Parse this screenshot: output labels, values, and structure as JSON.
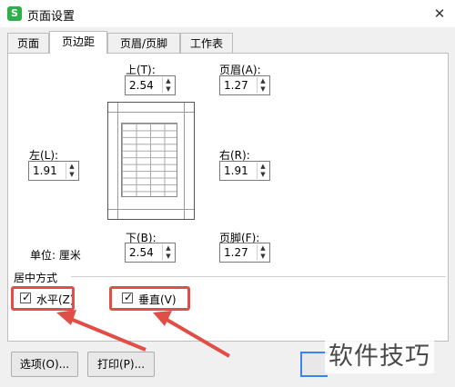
{
  "window": {
    "title": "页面设置",
    "app_icon_letter": "S",
    "close_glyph": "✕"
  },
  "tabs": [
    {
      "label": "页面",
      "active": false
    },
    {
      "label": "页边距",
      "active": true
    },
    {
      "label": "页眉/页脚",
      "active": false
    },
    {
      "label": "工作表",
      "active": false
    }
  ],
  "margins": {
    "top": {
      "label": "上(T):",
      "value": "2.54"
    },
    "header": {
      "label": "页眉(A):",
      "value": "1.27"
    },
    "left": {
      "label": "左(L):",
      "value": "1.91"
    },
    "right": {
      "label": "右(R):",
      "value": "1.91"
    },
    "bottom": {
      "label": "下(B):",
      "value": "2.54"
    },
    "footer": {
      "label": "页脚(F):",
      "value": "1.27"
    },
    "unit_label": "单位: 厘米"
  },
  "centering": {
    "group_label": "居中方式",
    "horizontal": {
      "label": "水平(Z)",
      "checked": true
    },
    "vertical": {
      "label": "垂直(V)",
      "checked": true
    }
  },
  "buttons": {
    "options": "选项(O)...",
    "print": "打印(P)..."
  },
  "watermark": "软件技巧",
  "colors": {
    "highlight": "#e04e46",
    "app_icon": "#2daf4a",
    "focus": "#3b82f6"
  }
}
